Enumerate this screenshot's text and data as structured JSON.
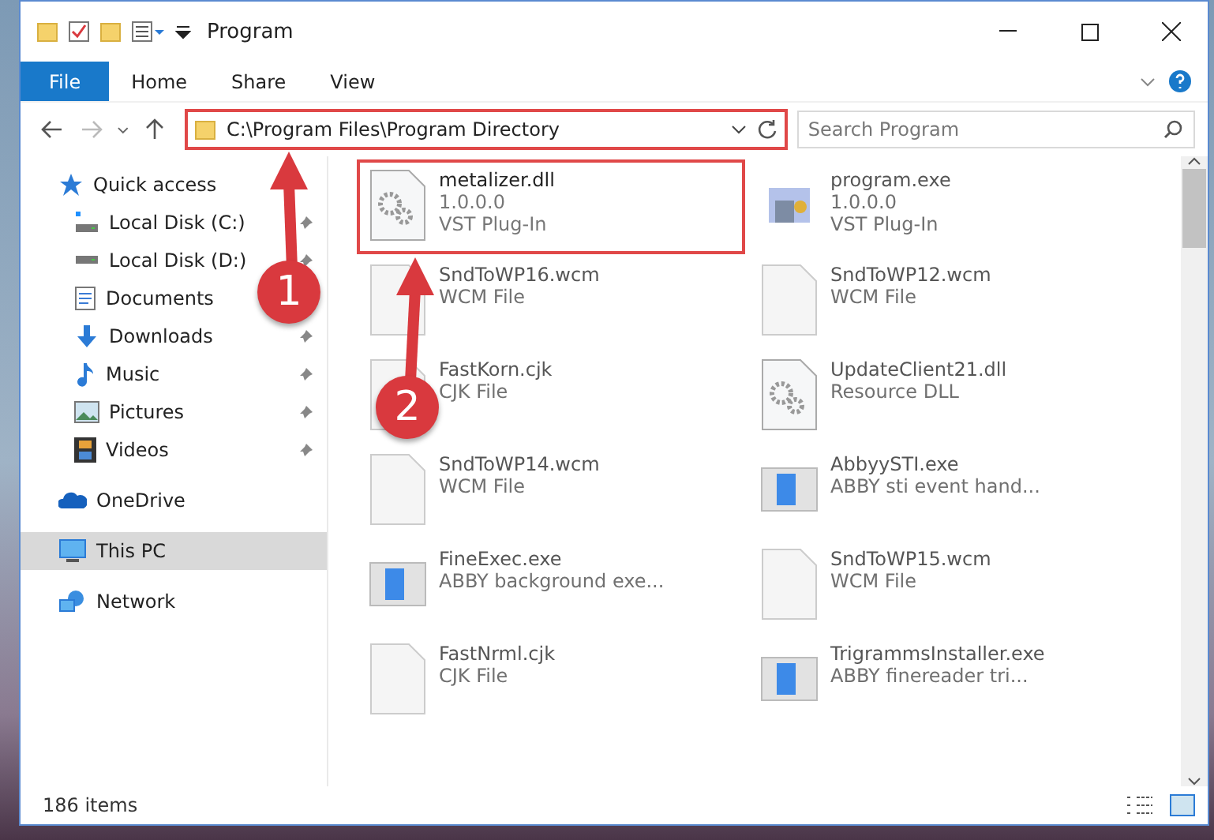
{
  "window": {
    "title": "Program"
  },
  "ribbon_tabs": [
    {
      "label": "File",
      "kind": "file"
    },
    {
      "label": "Home",
      "kind": "tab"
    },
    {
      "label": "Share",
      "kind": "tab"
    },
    {
      "label": "View",
      "kind": "tab"
    }
  ],
  "address_bar": {
    "path": "C:\\Program Files\\Program Directory",
    "highlighted": true
  },
  "search": {
    "placeholder": "Search Program"
  },
  "sidebar": {
    "items": [
      {
        "label": "Quick access",
        "pinned": false,
        "selected": false
      },
      {
        "label": "Local Disk (C:)",
        "pinned": true,
        "selected": false
      },
      {
        "label": "Local Disk (D:)",
        "pinned": true,
        "selected": false
      },
      {
        "label": "Documents",
        "pinned": false,
        "selected": false
      },
      {
        "label": "Downloads",
        "pinned": true,
        "selected": false
      },
      {
        "label": "Music",
        "pinned": true,
        "selected": false
      },
      {
        "label": "Pictures",
        "pinned": true,
        "selected": false
      },
      {
        "label": "Videos",
        "pinned": true,
        "selected": false
      },
      {
        "label": "OneDrive",
        "pinned": false,
        "selected": false
      },
      {
        "label": "This PC",
        "pinned": false,
        "selected": true
      },
      {
        "label": "Network",
        "pinned": false,
        "selected": false
      }
    ]
  },
  "files": [
    {
      "name": "metalizer.dll",
      "lines": [
        "1.0.0.0",
        "VST Plug-In"
      ],
      "kind": "gear",
      "faded": false,
      "highlighted": true
    },
    {
      "name": "program.exe",
      "lines": [
        "1.0.0.0",
        "VST Plug-In"
      ],
      "kind": "app",
      "faded": true,
      "highlighted": false
    },
    {
      "name": "SndToWP16.wcm",
      "lines": [
        "WCM File"
      ],
      "kind": "blank",
      "faded": true,
      "highlighted": false
    },
    {
      "name": "SndToWP12.wcm",
      "lines": [
        "WCM File"
      ],
      "kind": "blank",
      "faded": true,
      "highlighted": false
    },
    {
      "name": "FastKorn.cjk",
      "lines": [
        "CJK File"
      ],
      "kind": "blank",
      "faded": true,
      "highlighted": false
    },
    {
      "name": "UpdateClient21.dll",
      "lines": [
        "Resource DLL"
      ],
      "kind": "gear",
      "faded": true,
      "highlighted": false
    },
    {
      "name": "SndToWP14.wcm",
      "lines": [
        "WCM File"
      ],
      "kind": "blank",
      "faded": true,
      "highlighted": false
    },
    {
      "name": "AbbyySTI.exe",
      "lines": [
        "ABBY sti event hand..."
      ],
      "kind": "window",
      "faded": true,
      "highlighted": false
    },
    {
      "name": "FineExec.exe",
      "lines": [
        "ABBY background exe..."
      ],
      "kind": "window",
      "faded": true,
      "highlighted": false
    },
    {
      "name": "SndToWP15.wcm",
      "lines": [
        "WCM File"
      ],
      "kind": "blank",
      "faded": true,
      "highlighted": false
    },
    {
      "name": "FastNrml.cjk",
      "lines": [
        "CJK File"
      ],
      "kind": "blank",
      "faded": true,
      "highlighted": false
    },
    {
      "name": "TrigrammsInstaller.exe",
      "lines": [
        "ABBY finereader tri..."
      ],
      "kind": "window",
      "faded": true,
      "highlighted": false
    }
  ],
  "status_bar": {
    "count": "186 items"
  },
  "annotations": [
    {
      "label": "1"
    },
    {
      "label": "2"
    }
  ]
}
